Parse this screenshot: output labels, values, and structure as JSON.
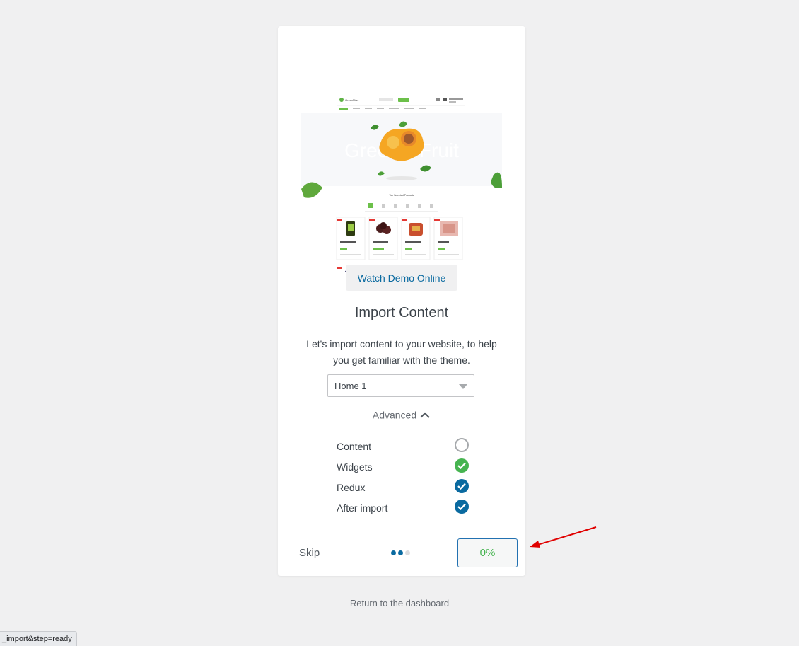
{
  "wizard": {
    "preview": {
      "logo_text": "GreenMart",
      "banner_text": "Greenly Fruit",
      "section_title": "Top Selected Products"
    },
    "demo_button_label": "Watch Demo Online",
    "title": "Import Content",
    "description": "Let's import content to your website, to help you get familiar with the theme.",
    "select": {
      "value": "Home 1",
      "options": [
        "Home 1"
      ]
    },
    "advanced_label": "Advanced",
    "options": [
      {
        "label": "Content",
        "checked": false,
        "color": ""
      },
      {
        "label": "Widgets",
        "checked": true,
        "color": "#46b450"
      },
      {
        "label": "Redux",
        "checked": true,
        "color": "#0a6aa0"
      },
      {
        "label": "After import",
        "checked": true,
        "color": "#0a6aa0"
      }
    ],
    "skip_label": "Skip",
    "steps": {
      "total": 3,
      "current": 2
    },
    "progress_label": "0%",
    "progress": 0
  },
  "return_link": "Return to the dashboard",
  "status_bar": "_import&step=ready",
  "colors": {
    "accent": "#0a6aa0",
    "success": "#46b450",
    "annotation": "#e00000"
  }
}
